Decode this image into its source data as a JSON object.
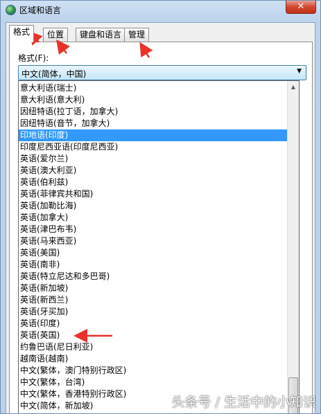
{
  "window": {
    "title": "区域和语言",
    "close_glyph": "✕"
  },
  "tabs": [
    {
      "label": "格式",
      "active": true
    },
    {
      "label": "位置",
      "active": false
    },
    {
      "label": "键盘和语言",
      "active": false
    },
    {
      "label": "管理",
      "active": false
    }
  ],
  "format": {
    "label": "格式(F):",
    "selected_value": "中文(简体，中国)",
    "options": [
      "意大利语(瑞士)",
      "意大利语(意大利)",
      "因纽特语(拉丁语，加拿大)",
      "因纽特语(音节，加拿大)",
      "印地语(印度)",
      "印度尼西亚语(印度尼西亚)",
      "英语(爱尔兰)",
      "英语(澳大利亚)",
      "英语(伯利兹)",
      "英语(菲律宾共和国)",
      "英语(加勒比海)",
      "英语(加拿大)",
      "英语(津巴布韦)",
      "英语(马来西亚)",
      "英语(美国)",
      "英语(南非)",
      "英语(特立尼达和多巴哥)",
      "英语(新加坡)",
      "英语(新西兰)",
      "英语(牙买加)",
      "英语(印度)",
      "英语(英国)",
      "约鲁巴语(尼日利亚)",
      "越南语(越南)",
      "中文(繁体，澳门特别行政区)",
      "中文(繁体，台湾)",
      "中文(繁体，香港特别行政区)",
      "中文(简体，新加坡)",
      "中文(简体，中国)"
    ],
    "highlighted_option": "印地语(印度)"
  },
  "watermark": "头条号 / 生活中的小知识",
  "colors": {
    "selection": "#3399ff",
    "annotation_arrow": "#e8322a"
  }
}
